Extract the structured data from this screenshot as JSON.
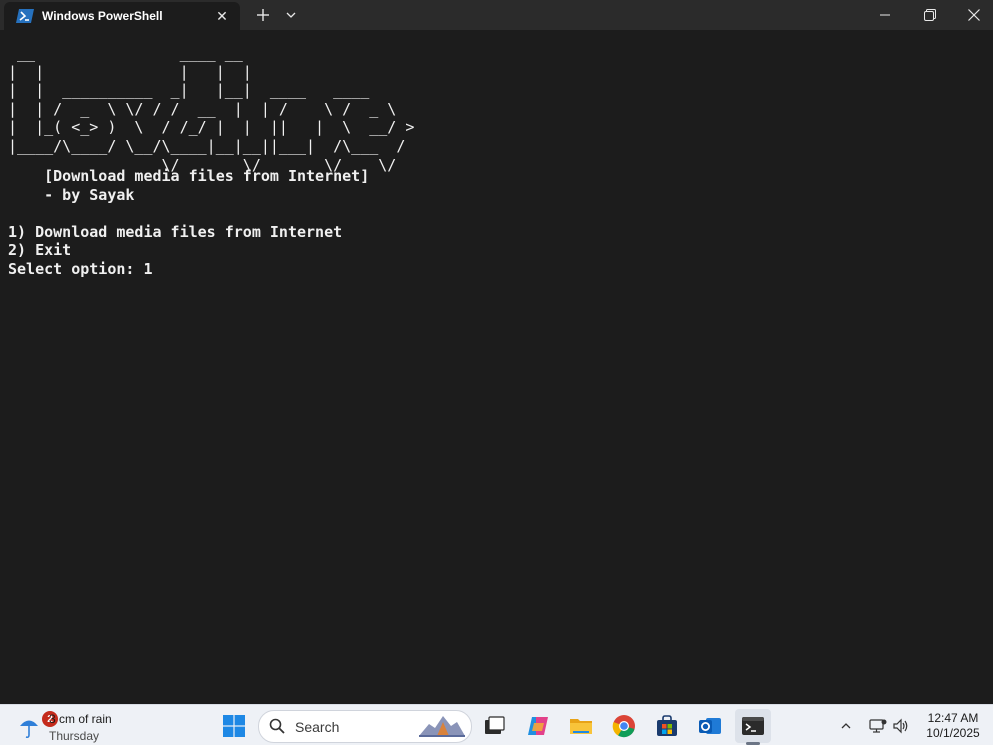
{
  "window": {
    "tab_title": "Windows PowerShell",
    "close_tab_glyph": "✕",
    "new_tab_glyph": "+",
    "minimize_glyph": "—",
    "restore_glyph": "❐",
    "close_glyph": "✕"
  },
  "terminal": {
    "banner": [
      " __                ____ __",
      "|  |               |   |  |",
      "|  |  __________  _|   |__|  ____   ____",
      "|  | /  _  \\ \\/ / /  __  |  | /    \\ /  _ \\",
      "|  |_( <_> )  \\  / /_/ |  |  ||   |  \\  __/ >",
      "|____/\\____/ \\__/\\____|__|__||___|  /\\___  /",
      "                 \\/       \\/       \\/    \\/"
    ],
    "subtitle": "    [Download media files from Internet]",
    "author": "    - by Sayak",
    "menu_1": "1) Download media files from Internet",
    "menu_2": "2) Exit",
    "prompt": "Select option: 1"
  },
  "taskbar": {
    "weather_badge": "2",
    "weather_main": "3 cm of rain",
    "weather_day": "Thursday",
    "search_placeholder": "Search",
    "clock_time": "12:47 AM",
    "clock_date": "10/1/2025"
  },
  "colors": {
    "terminal_bg": "#1c1c1c",
    "titlebar_bg": "#2b2b2b",
    "taskbar_bg": "#eef1f6",
    "powershell_blue": "#2671be"
  }
}
